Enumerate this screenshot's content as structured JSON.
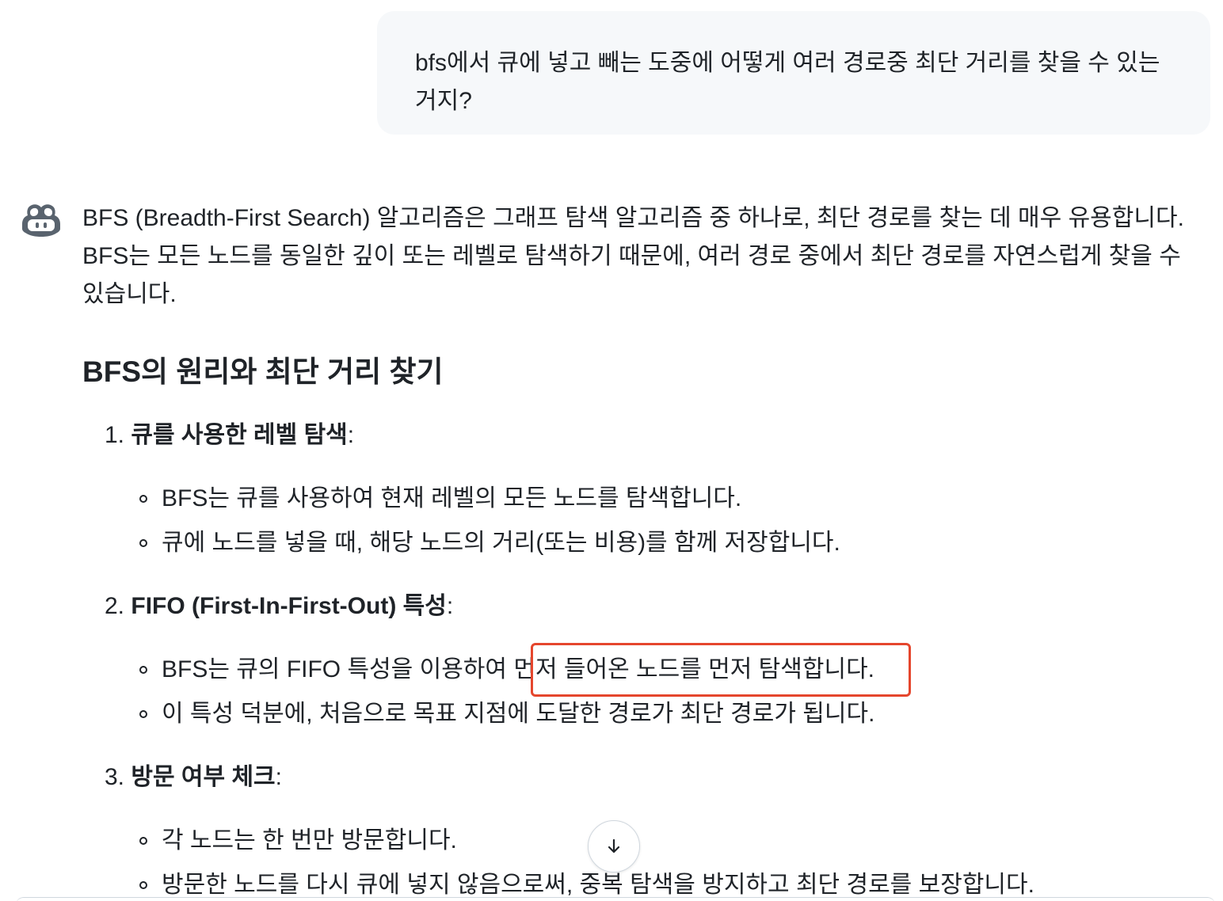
{
  "user_message": {
    "line1": "bfs에서 큐에 넣고 빼는 도중에 어떻게 여러 경로중 최단 거리를 찾을 수 있는",
    "line2": "거지?"
  },
  "assistant": {
    "avatar_icon": "copilot-icon",
    "intro_lines": [
      "BFS (Breadth-First Search) 알고리즘은 그래프 탐색 알고리즘 중 하나로, 최단 경로를 찾는 데 매우 유용합니다.",
      "BFS는 모든 노드를 동일한 깊이 또는 레벨로 탐색하기 때문에, 여러 경로 중에서 최단 경로를 자연스럽게 찾을 수",
      "있습니다."
    ],
    "heading": "BFS의 원리와 최단 거리 찾기",
    "sections": [
      {
        "number": "1.",
        "title": "큐를 사용한 레벨 탐색",
        "bullets": [
          "BFS는 큐를 사용하여 현재 레벨의 모든 노드를 탐색합니다.",
          "큐에 노드를 넣을 때, 해당 노드의 거리(또는 비용)를 함께 저장합니다."
        ]
      },
      {
        "number": "2.",
        "title": "FIFO (First-In-First-Out) 특성",
        "bullets": [
          "BFS는 큐의 FIFO 특성을 이용하여 ",
          "이 특성 덕분에, 처음으로 목표 지점에 도달한 경로가 최단 경로가 됩니다."
        ],
        "highlighted_text": "먼저 들어온 노드를 먼저 탐색합니다."
      },
      {
        "number": "3.",
        "title": "방문 여부 체크",
        "bullets": [
          "각 노드는 한 번만 방문합니다.",
          "방문한 노드를 다시 큐에 넣지 않음으로써, 중복 탐색을 방지하고 최단 경로를 보장합니다."
        ]
      }
    ],
    "colon": ":"
  },
  "controls": {
    "scroll_down_icon": "arrow-down-icon"
  },
  "colors": {
    "highlight_border": "#e5462d",
    "bubble_bg": "#f6f8fa",
    "text": "#1f2328"
  }
}
